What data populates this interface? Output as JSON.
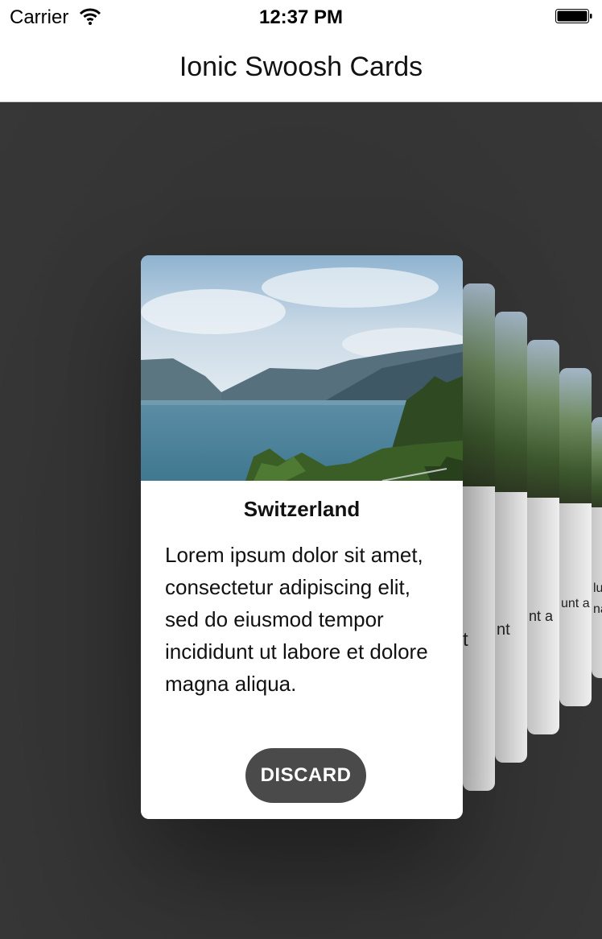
{
  "status_bar": {
    "carrier": "Carrier",
    "time": "12:37 PM",
    "wifi_icon": "wifi-icon",
    "battery_icon": "battery-icon"
  },
  "nav": {
    "title": "Ionic Swoosh Cards"
  },
  "cards": {
    "front": {
      "title": "Switzerland",
      "body": "Lorem ipsum dolor sit amet, consectetur adipiscing elit, sed do eiusmod tempor incididunt ut labore et dolore magna aliqua.",
      "button_label": "DISCARD"
    },
    "stack_snippets": [
      "t",
      "nt",
      "nt a",
      "unt a",
      "lur na"
    ]
  },
  "colors": {
    "background": "#333333",
    "button": "#4a4a4a",
    "card": "#ffffff"
  }
}
